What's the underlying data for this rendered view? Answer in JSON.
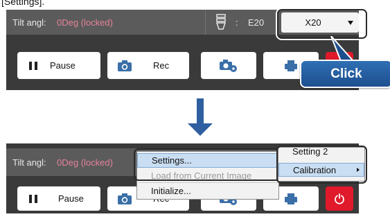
{
  "doc_label": "[Settings].",
  "top": {
    "tilt_label": "Tilt angl:",
    "tilt_value": "0Deg (locked)",
    "lens_colon": ":",
    "lens_code": "E20",
    "zoom_value": "X20",
    "pause_label": "Pause",
    "rec_label": "Rec",
    "click_label": "Click"
  },
  "bottom": {
    "tilt_label": "Tilt angl:",
    "tilt_value": "0Deg (locked)",
    "pause_label": "Pause",
    "rec_label": "Rec"
  },
  "context_menu": {
    "items": [
      {
        "label": "Settings...",
        "state": "hover"
      },
      {
        "label": "Load from Current Image",
        "state": "disabled"
      },
      {
        "label": "Initialize...",
        "state": "enabled"
      }
    ]
  },
  "submenu": {
    "items": [
      {
        "label": "Setting 2"
      },
      {
        "label": "Calibration"
      }
    ]
  },
  "colors": {
    "panel_bg": "#3a3a3a",
    "status_bg": "#5b5b5b",
    "tilt_value_color": "#e5829a",
    "power_button_red": "#e0192b",
    "callout_blue": "#1d4f8e",
    "arrow_blue": "#2f5fa0",
    "menu_highlight": "#c9def2"
  },
  "icons": [
    "pause-icon",
    "camera-icon",
    "camera-settings-icon",
    "printer-icon",
    "power-icon",
    "lens-icon",
    "chevron-down-icon",
    "chevron-right-icon",
    "down-arrow-icon"
  ]
}
